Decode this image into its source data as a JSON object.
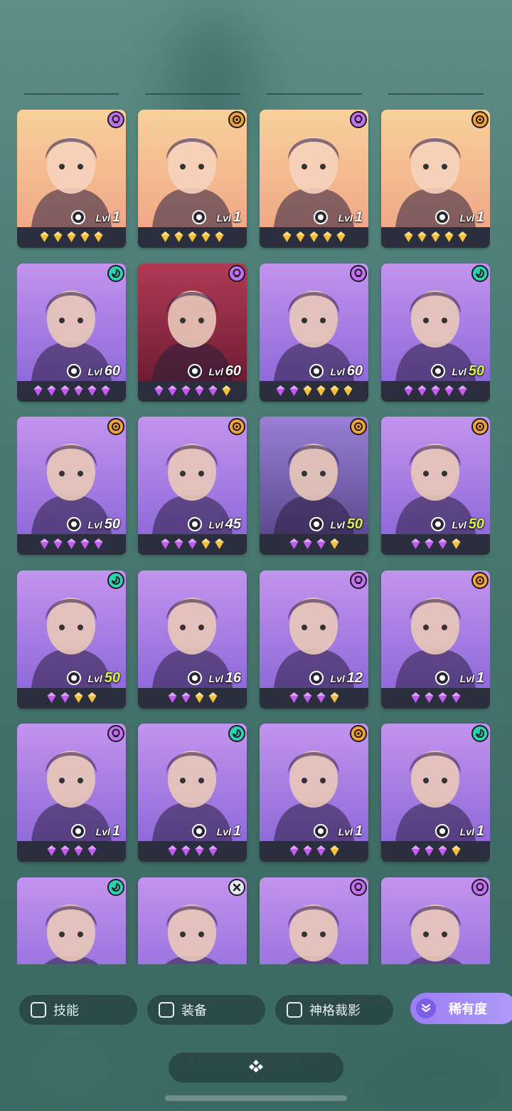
{
  "colors": {
    "card_gold_bg": "#f4c38a",
    "card_purple_bg": "#b58be6",
    "gem_gold": "#f6c13a",
    "gem_purple": "#c55cf2",
    "level_green": "#d8f24a",
    "role_mage": "#c46ef0",
    "role_warrior": "#f3a23a",
    "role_support": "#2fd0b0",
    "role_assassin": "#e6e6f0",
    "rarity_button": "#9c7df5"
  },
  "level_prefix": "Lvl",
  "heroes": [
    {
      "level": "1",
      "gems": [
        "gold",
        "gold",
        "gold",
        "gold",
        "gold"
      ],
      "role_icon": "mage-icon",
      "theme": "gold",
      "level_style": "white"
    },
    {
      "level": "1",
      "gems": [
        "gold",
        "gold",
        "gold",
        "gold",
        "gold"
      ],
      "role_icon": "warrior-icon",
      "theme": "gold",
      "level_style": "white"
    },
    {
      "level": "1",
      "gems": [
        "gold",
        "gold",
        "gold",
        "gold",
        "gold"
      ],
      "role_icon": "mage-icon",
      "theme": "gold",
      "level_style": "white"
    },
    {
      "level": "1",
      "gems": [
        "gold",
        "gold",
        "gold",
        "gold",
        "gold"
      ],
      "role_icon": "warrior-icon",
      "theme": "gold",
      "level_style": "white"
    },
    {
      "level": "60",
      "gems": [
        "purple",
        "purple",
        "purple",
        "purple",
        "purple",
        "purple"
      ],
      "role_icon": "support-icon",
      "theme": "purple",
      "level_style": "white"
    },
    {
      "level": "60",
      "gems": [
        "purple",
        "purple",
        "purple",
        "purple",
        "purple",
        "gold"
      ],
      "role_icon": "mage-icon",
      "theme": "red",
      "level_style": "white"
    },
    {
      "level": "60",
      "gems": [
        "purple",
        "purple",
        "gold",
        "gold",
        "gold",
        "gold"
      ],
      "role_icon": "mage-icon",
      "theme": "purple",
      "level_style": "white"
    },
    {
      "level": "50",
      "gems": [
        "purple",
        "purple",
        "purple",
        "purple",
        "purple"
      ],
      "role_icon": "support-icon",
      "theme": "purple",
      "level_style": "green"
    },
    {
      "level": "50",
      "gems": [
        "purple",
        "purple",
        "purple",
        "purple",
        "purple"
      ],
      "role_icon": "warrior-icon",
      "theme": "purple",
      "level_style": "white"
    },
    {
      "level": "45",
      "gems": [
        "purple",
        "purple",
        "purple",
        "gold",
        "gold"
      ],
      "role_icon": "warrior-icon",
      "theme": "purple",
      "level_style": "white"
    },
    {
      "level": "50",
      "gems": [
        "purple",
        "purple",
        "purple",
        "gold"
      ],
      "role_icon": "warrior-icon",
      "theme": "dark",
      "level_style": "green"
    },
    {
      "level": "50",
      "gems": [
        "purple",
        "purple",
        "purple",
        "gold"
      ],
      "role_icon": "warrior-icon",
      "theme": "purple",
      "level_style": "green"
    },
    {
      "level": "50",
      "gems": [
        "purple",
        "purple",
        "gold",
        "gold"
      ],
      "role_icon": "support-icon",
      "theme": "purple",
      "level_style": "green"
    },
    {
      "level": "16",
      "gems": [
        "purple",
        "purple",
        "gold",
        "gold"
      ],
      "role_icon": "none",
      "theme": "purple",
      "level_style": "white"
    },
    {
      "level": "12",
      "gems": [
        "purple",
        "purple",
        "purple",
        "gold"
      ],
      "role_icon": "mage-icon",
      "theme": "purple",
      "level_style": "white"
    },
    {
      "level": "1",
      "gems": [
        "purple",
        "purple",
        "purple",
        "purple"
      ],
      "role_icon": "warrior-icon",
      "theme": "purple",
      "level_style": "white"
    },
    {
      "level": "1",
      "gems": [
        "purple",
        "purple",
        "purple",
        "purple"
      ],
      "role_icon": "mage-icon",
      "theme": "purple",
      "level_style": "white"
    },
    {
      "level": "1",
      "gems": [
        "purple",
        "purple",
        "purple",
        "purple"
      ],
      "role_icon": "support-icon",
      "theme": "purple",
      "level_style": "white"
    },
    {
      "level": "1",
      "gems": [
        "purple",
        "purple",
        "purple",
        "gold"
      ],
      "role_icon": "warrior-icon",
      "theme": "purple",
      "level_style": "white"
    },
    {
      "level": "1",
      "gems": [
        "purple",
        "purple",
        "purple",
        "gold"
      ],
      "role_icon": "support-icon",
      "theme": "purple",
      "level_style": "white"
    },
    {
      "level": "",
      "gems": [],
      "role_icon": "support-icon",
      "theme": "purple",
      "level_style": "white"
    },
    {
      "level": "",
      "gems": [],
      "role_icon": "assassin-icon",
      "theme": "purple",
      "level_style": "white"
    },
    {
      "level": "",
      "gems": [],
      "role_icon": "mage-icon",
      "theme": "purple",
      "level_style": "white"
    },
    {
      "level": "",
      "gems": [],
      "role_icon": "mage-icon",
      "theme": "purple",
      "level_style": "white"
    }
  ],
  "filters": {
    "skill": "技能",
    "equipment": "装备",
    "divine": "神格裁影",
    "rarity": "稀有度"
  }
}
